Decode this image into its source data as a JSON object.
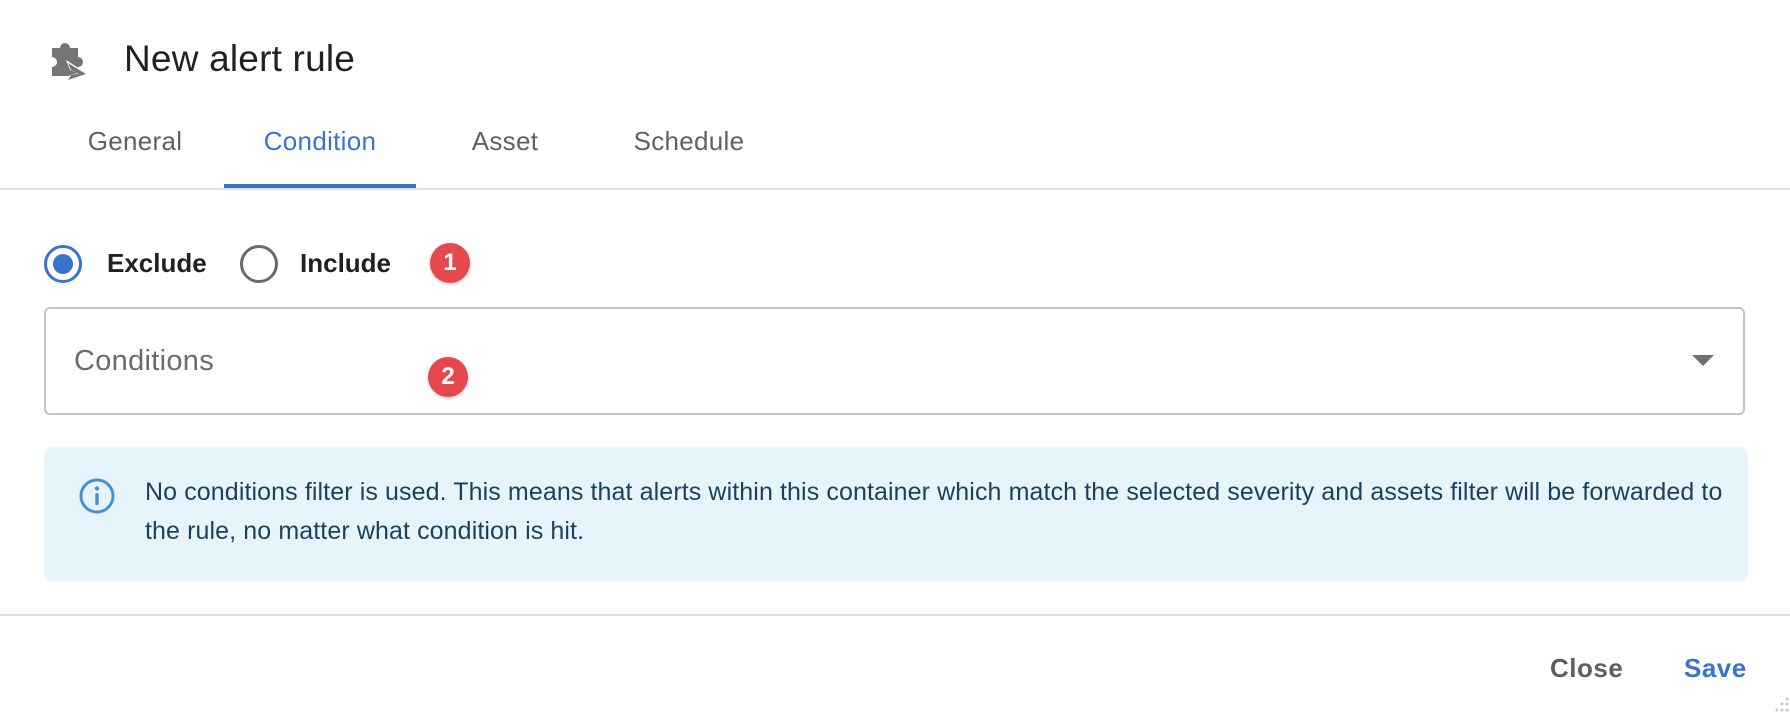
{
  "dialog": {
    "title": "New alert rule",
    "icon": "extension-puzzle-send-icon"
  },
  "tabs": [
    {
      "label": "General",
      "active": false
    },
    {
      "label": "Condition",
      "active": true
    },
    {
      "label": "Asset",
      "active": false
    },
    {
      "label": "Schedule",
      "active": false
    }
  ],
  "condition": {
    "mode_options": [
      {
        "label": "Exclude",
        "checked": true
      },
      {
        "label": "Include",
        "checked": false
      }
    ],
    "conditions_select": {
      "placeholder": "Conditions",
      "value": ""
    },
    "info_message": "No conditions filter is used. This means that alerts within this container which match the selected severity and assets filter will be forwarded to the rule, no matter what condition is hit."
  },
  "annotations": [
    {
      "label": "1"
    },
    {
      "label": "2"
    }
  ],
  "footer": {
    "close_label": "Close",
    "save_label": "Save"
  },
  "colors": {
    "accent": "#3a73cc",
    "badge": "#e5484d",
    "info_background": "#e7f4fc",
    "info_text": "#1c3f5e"
  }
}
